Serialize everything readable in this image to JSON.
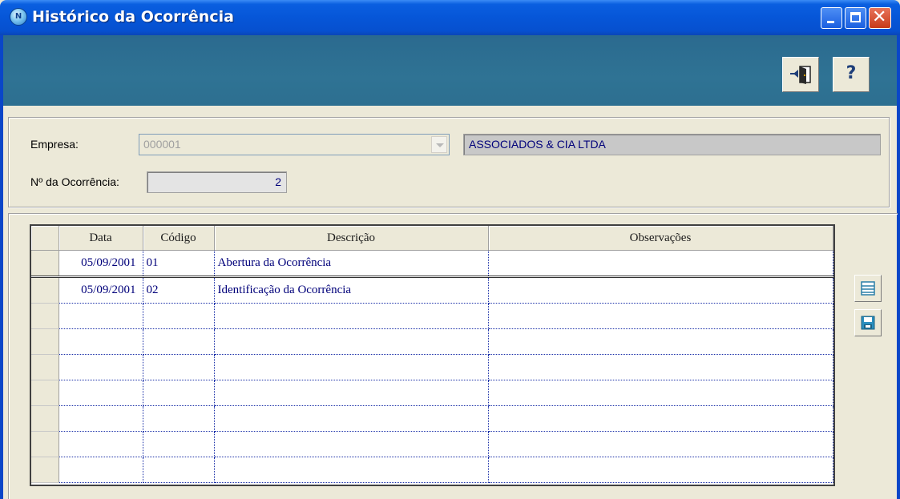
{
  "window": {
    "title": "Histórico da Ocorrência",
    "colors": {
      "titlebar": "#0656d8",
      "toolbar_band": "#2f7394",
      "value_text": "#00007a"
    }
  },
  "toolbar": {
    "exit_icon": "exit-door-icon",
    "help_label": "?"
  },
  "form": {
    "empresa_label": "Empresa:",
    "empresa_code": "000001",
    "empresa_name": "ASSOCIADOS & CIA LTDA",
    "ocorrencia_label": "Nº da Ocorrência:",
    "ocorrencia_value": "2"
  },
  "grid": {
    "headers": [
      "Data",
      "Código",
      "Descrição",
      "Observações"
    ],
    "rows": [
      {
        "data": "05/09/2001",
        "codigo": "01",
        "descricao": "Abertura da Ocorrência",
        "observacoes": ""
      },
      {
        "data": "05/09/2001",
        "codigo": "02",
        "descricao": "Identificação da Ocorrência",
        "observacoes": ""
      },
      {
        "data": "",
        "codigo": "",
        "descricao": "",
        "observacoes": ""
      },
      {
        "data": "",
        "codigo": "",
        "descricao": "",
        "observacoes": ""
      },
      {
        "data": "",
        "codigo": "",
        "descricao": "",
        "observacoes": ""
      },
      {
        "data": "",
        "codigo": "",
        "descricao": "",
        "observacoes": ""
      },
      {
        "data": "",
        "codigo": "",
        "descricao": "",
        "observacoes": ""
      },
      {
        "data": "",
        "codigo": "",
        "descricao": "",
        "observacoes": ""
      },
      {
        "data": "",
        "codigo": "",
        "descricao": "",
        "observacoes": ""
      }
    ]
  },
  "side_buttons": {
    "list_icon": "list-icon",
    "save_icon": "save-disk-icon"
  }
}
